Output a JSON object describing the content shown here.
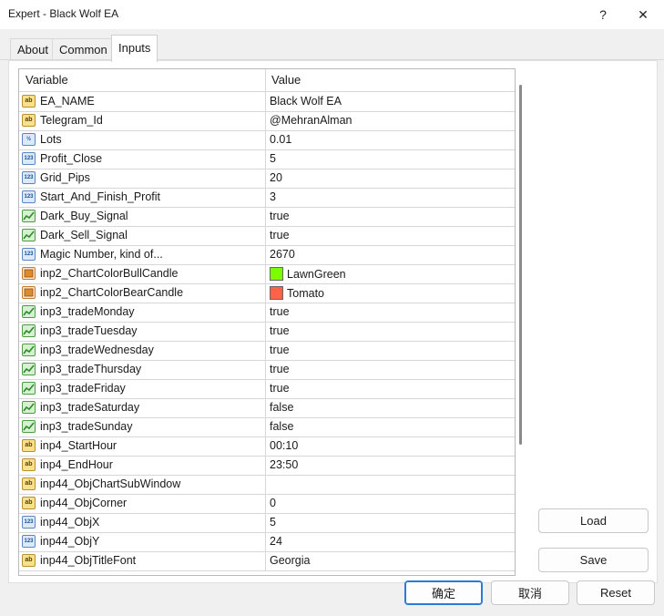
{
  "window": {
    "title": "Expert - Black Wolf EA",
    "help_label": "?",
    "close_label": "✕"
  },
  "tabs": [
    {
      "label": "About"
    },
    {
      "label": "Common"
    },
    {
      "label": "Inputs"
    }
  ],
  "table": {
    "headers": {
      "variable": "Variable",
      "value": "Value"
    },
    "rows": [
      {
        "icon": "string-icon",
        "name": "EA_NAME",
        "value": "Black Wolf EA"
      },
      {
        "icon": "string-icon",
        "name": "Telegram_Id",
        "value": "@MehranAlman"
      },
      {
        "icon": "double-icon",
        "name": "Lots",
        "value": "0.01"
      },
      {
        "icon": "integer-icon",
        "name": "Profit_Close",
        "value": "5"
      },
      {
        "icon": "integer-icon",
        "name": "Grid_Pips",
        "value": "20"
      },
      {
        "icon": "integer-icon",
        "name": "Start_And_Finish_Profit",
        "value": "3"
      },
      {
        "icon": "bool-icon",
        "name": "Dark_Buy_Signal",
        "value": "true"
      },
      {
        "icon": "bool-icon",
        "name": "Dark_Sell_Signal",
        "value": "true"
      },
      {
        "icon": "integer-icon",
        "name": "Magic Number, kind of...",
        "value": "2670"
      },
      {
        "icon": "color-icon",
        "name": "inp2_ChartColorBullCandle",
        "value": "LawnGreen",
        "swatch": "#7cfc00"
      },
      {
        "icon": "color-icon",
        "name": "inp2_ChartColorBearCandle",
        "value": "Tomato",
        "swatch": "#ff6347"
      },
      {
        "icon": "bool-icon",
        "name": "inp3_tradeMonday",
        "value": "true"
      },
      {
        "icon": "bool-icon",
        "name": "inp3_tradeTuesday",
        "value": "true"
      },
      {
        "icon": "bool-icon",
        "name": "inp3_tradeWednesday",
        "value": "true"
      },
      {
        "icon": "bool-icon",
        "name": "inp3_tradeThursday",
        "value": "true"
      },
      {
        "icon": "bool-icon",
        "name": "inp3_tradeFriday",
        "value": "true"
      },
      {
        "icon": "bool-icon",
        "name": "inp3_tradeSaturday",
        "value": "false"
      },
      {
        "icon": "bool-icon",
        "name": "inp3_tradeSunday",
        "value": "false"
      },
      {
        "icon": "string-icon",
        "name": "inp4_StartHour",
        "value": "00:10"
      },
      {
        "icon": "string-icon",
        "name": "inp4_EndHour",
        "value": "23:50"
      },
      {
        "icon": "string-icon",
        "name": "inp44_ObjChartSubWindow",
        "value": ""
      },
      {
        "icon": "string-icon",
        "name": "inp44_ObjCorner",
        "value": "0"
      },
      {
        "icon": "integer-icon",
        "name": "inp44_ObjX",
        "value": "5"
      },
      {
        "icon": "integer-icon",
        "name": "inp44_ObjY",
        "value": "24"
      },
      {
        "icon": "string-icon",
        "name": "inp44_ObjTitleFont",
        "value": "Georgia"
      }
    ]
  },
  "icon_glyphs": {
    "string-icon": "ab",
    "integer-icon": "123",
    "double-icon": "½",
    "bool-icon": "",
    "color-icon": ""
  },
  "buttons": {
    "load": "Load",
    "save": "Save",
    "ok": "确定",
    "cancel": "取消",
    "reset": "Reset"
  },
  "colors": {
    "accent": "#2a7bd4",
    "bool_line": "#2e8b2a",
    "color_icon_fill": "#e08a2e"
  }
}
